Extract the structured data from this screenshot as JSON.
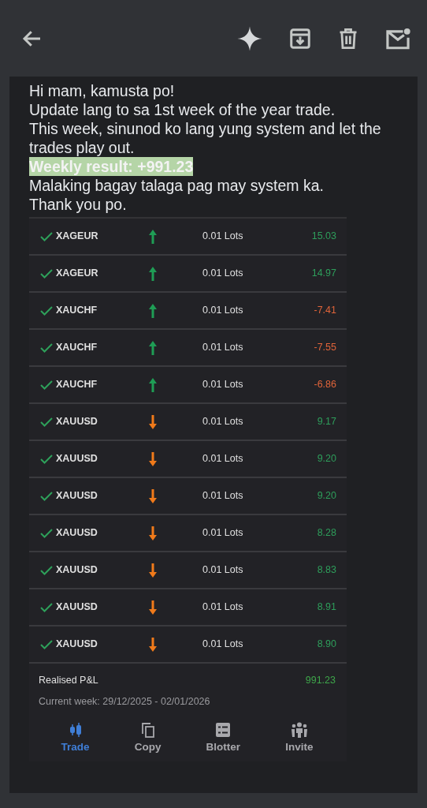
{
  "toolbar": {
    "actions": [
      {
        "kind": "back"
      },
      {
        "kind": "sparkle"
      },
      {
        "kind": "archive"
      },
      {
        "kind": "delete"
      },
      {
        "kind": "unread"
      }
    ]
  },
  "message": {
    "lines": [
      {
        "kind": "plain",
        "text": "Hi mam, kamusta po!"
      },
      {
        "kind": "plain",
        "text": "Update lang to sa 1st week of the year trade."
      },
      {
        "kind": "plain",
        "text": "This week, sinunod ko lang yung system and let the trades play out."
      },
      {
        "kind": "highlight",
        "text": "Weekly result: +991.23"
      },
      {
        "kind": "plain",
        "text": "Malaking bagay talaga pag may system ka."
      },
      {
        "kind": "plain",
        "text": "Thank you po."
      }
    ]
  },
  "trades": [
    {
      "symbol": "XAGEUR",
      "kind": "up",
      "lots": "0.01 Lots",
      "pnl": "15.03",
      "color": "#2e9e5b"
    },
    {
      "symbol": "XAGEUR",
      "kind": "up",
      "lots": "0.01 Lots",
      "pnl": "14.97",
      "color": "#2e9e5b"
    },
    {
      "symbol": "XAUCHF",
      "kind": "up",
      "lots": "0.01 Lots",
      "pnl": "-7.41",
      "color": "#e0643a"
    },
    {
      "symbol": "XAUCHF",
      "kind": "up",
      "lots": "0.01 Lots",
      "pnl": "-7.55",
      "color": "#e0643a"
    },
    {
      "symbol": "XAUCHF",
      "kind": "up",
      "lots": "0.01 Lots",
      "pnl": "-6.86",
      "color": "#e0643a"
    },
    {
      "symbol": "XAUUSD",
      "kind": "down",
      "lots": "0.01 Lots",
      "pnl": "9.17",
      "color": "#2e9e5b"
    },
    {
      "symbol": "XAUUSD",
      "kind": "down",
      "lots": "0.01 Lots",
      "pnl": "9.20",
      "color": "#2e9e5b"
    },
    {
      "symbol": "XAUUSD",
      "kind": "down",
      "lots": "0.01 Lots",
      "pnl": "9.20",
      "color": "#2e9e5b"
    },
    {
      "symbol": "XAUUSD",
      "kind": "down",
      "lots": "0.01 Lots",
      "pnl": "8.28",
      "color": "#2e9e5b"
    },
    {
      "symbol": "XAUUSD",
      "kind": "down",
      "lots": "0.01 Lots",
      "pnl": "8.83",
      "color": "#2e9e5b"
    },
    {
      "symbol": "XAUUSD",
      "kind": "down",
      "lots": "0.01 Lots",
      "pnl": "8.91",
      "color": "#2e9e5b"
    },
    {
      "symbol": "XAUUSD",
      "kind": "down",
      "lots": "0.01 Lots",
      "pnl": "8.90",
      "color": "#2e9e5b"
    }
  ],
  "summary": {
    "label": "Realised P&L",
    "value": "991.23",
    "period": "Current week: 29/12/2025 - 02/01/2026"
  },
  "nav": [
    {
      "kind": "trade",
      "label": "Trade",
      "selected": true
    },
    {
      "kind": "copy",
      "label": "Copy",
      "selected": false
    },
    {
      "kind": "blotter",
      "label": "Blotter",
      "selected": false
    },
    {
      "kind": "invite",
      "label": "Invite",
      "selected": false
    }
  ]
}
